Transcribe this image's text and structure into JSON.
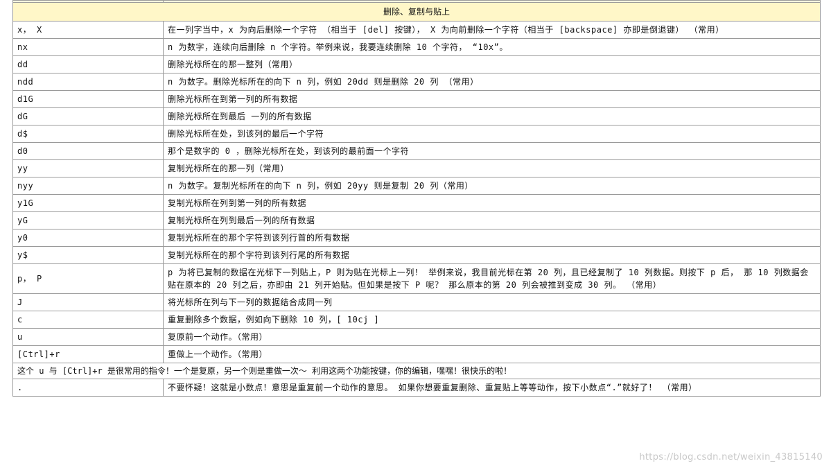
{
  "section_title": "删除、复制与贴上",
  "rows": [
    {
      "cmd": "x， X",
      "desc": "在一列字当中，x 为向后删除一个字符 （相当于 [del] 按键）， X 为向前删除一个字符（相当于 [backspace] 亦即是倒退键） （常用）"
    },
    {
      "cmd": "nx",
      "desc": "n 为数字，连续向后删除 n 个字符。举例来说，我要连续删除 10 个字符， “10x”。"
    },
    {
      "cmd": "dd",
      "desc": "删除光标所在的那一整列（常用）"
    },
    {
      "cmd": "ndd",
      "desc": "n 为数字。删除光标所在的向下 n 列，例如 20dd 则是删除 20 列 （常用）"
    },
    {
      "cmd": "d1G",
      "desc": "删除光标所在到第一列的所有数据"
    },
    {
      "cmd": "dG",
      "desc": "删除光标所在到最后 一列的所有数据"
    },
    {
      "cmd": "d$",
      "desc": "删除光标所在处，到该列的最后一个字符"
    },
    {
      "cmd": "d0",
      "desc": "那个是数字的 0 ，删除光标所在处，到该列的最前面一个字符"
    },
    {
      "cmd": "yy",
      "desc": "复制光标所在的那一列（常用）"
    },
    {
      "cmd": "nyy",
      "desc": "n 为数字。复制光标所在的向下 n 列，例如 20yy 则是复制 20 列（常用）"
    },
    {
      "cmd": "y1G",
      "desc": "复制光标所在列到第一列的所有数据"
    },
    {
      "cmd": "yG",
      "desc": "复制光标所在列到最后一列的所有数据"
    },
    {
      "cmd": "y0",
      "desc": "复制光标所在的那个字符到该列行首的所有数据"
    },
    {
      "cmd": "y$",
      "desc": "复制光标所在的那个字符到该列行尾的所有数据"
    },
    {
      "cmd": "p， P",
      "desc": "p 为将已复制的数据在光标下一列贴上，P 则为贴在光标上一列！ 举例来说，我目前光标在第 20 列，且已经复制了 10 列数据。则按下 p 后， 那 10 列数据会贴在原本的 20 列之后，亦即由 21 列开始贴。但如果是按下 P 呢？ 那么原本的第 20 列会被推到变成 30 列。 （常用）"
    },
    {
      "cmd": "J",
      "desc": "将光标所在列与下一列的数据结合成同一列"
    },
    {
      "cmd": "c",
      "desc": "重复删除多个数据，例如向下删除 10 列，[ 10cj ]"
    },
    {
      "cmd": "u",
      "desc": "复原前一个动作。（常用）"
    },
    {
      "cmd": "[Ctrl]+r",
      "desc": "重做上一个动作。（常用）"
    }
  ],
  "note": "这个 u 与 [Ctrl]+r 是很常用的指令！一个是复原，另一个则是重做一次～ 利用这两个功能按键，你的编辑，嘿嘿！很快乐的啦！",
  "dot_row": {
    "cmd": ".",
    "desc": "不要怀疑！这就是小数点！意思是重复前一个动作的意思。 如果你想要重复删除、重复贴上等等动作，按下小数点“.”就好了！ （常用）"
  },
  "watermark": "https://blog.csdn.net/weixin_43815140",
  "colors": {
    "section_bg": "#fff7c8",
    "border": "#9a9a9a"
  }
}
